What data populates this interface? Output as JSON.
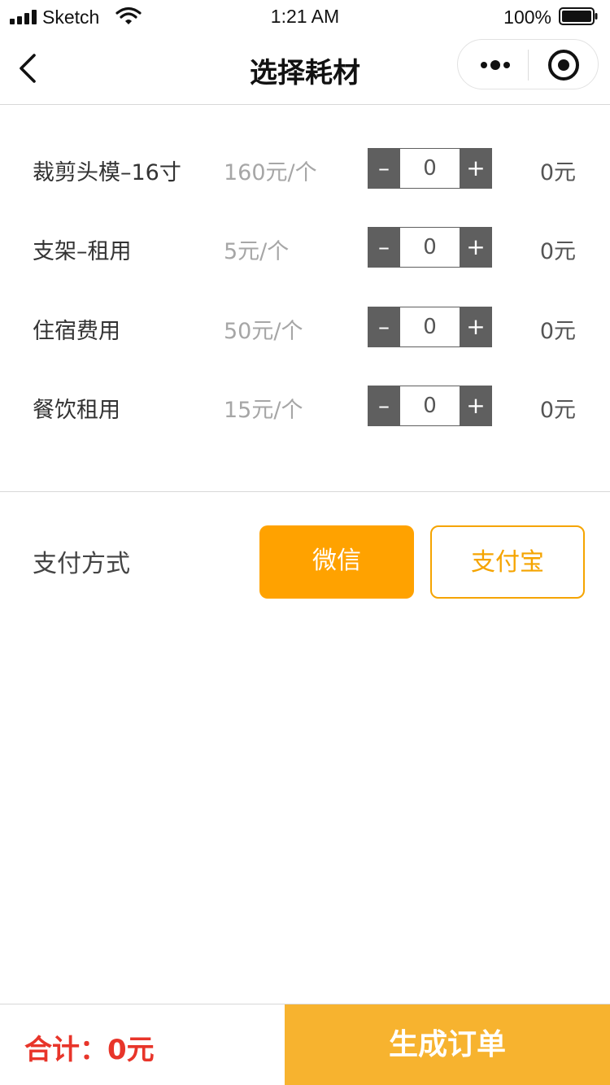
{
  "status_bar": {
    "carrier": "Sketch",
    "time": "1:21 AM",
    "battery": "100%"
  },
  "nav": {
    "title": "选择耗材",
    "icons": [
      "back-arrow-icon",
      "more-dots-icon",
      "record-target-icon"
    ]
  },
  "items": [
    {
      "name": "裁剪头模–16寸",
      "price": "160元/个",
      "quantity": "0",
      "subtotal": "0元"
    },
    {
      "name": "支架–租用",
      "price": "5元/个",
      "quantity": "0",
      "subtotal": "0元"
    },
    {
      "name": "住宿费用",
      "price": "50元/个",
      "quantity": "0",
      "subtotal": "0元"
    },
    {
      "name": "餐饮租用",
      "price": "15元/个",
      "quantity": "0",
      "subtotal": "0元"
    }
  ],
  "stepper": {
    "minus": "–",
    "plus": "+"
  },
  "payment": {
    "label": "支付方式",
    "options": [
      {
        "label": "微信",
        "selected": true
      },
      {
        "label": "支付宝",
        "selected": false
      }
    ]
  },
  "footer": {
    "total": "合计：0元",
    "submit": "生成订单"
  },
  "colors": {
    "accent": "#ffa200",
    "submit": "#f7b32f",
    "total": "#e8352a",
    "stepper": "#5f5f5f"
  }
}
